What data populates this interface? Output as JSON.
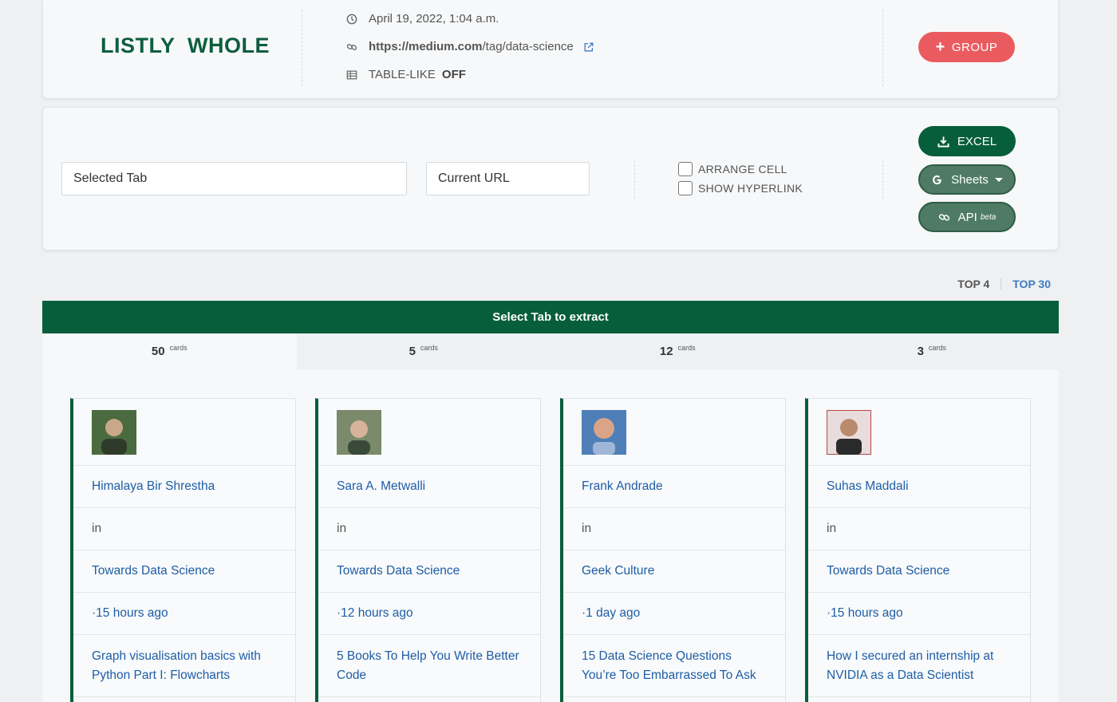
{
  "header": {
    "brand": "LISTLY  WHOLE",
    "timestamp": "April 19, 2022, 1:04 a.m.",
    "url_host": "https://medium.com",
    "url_path": "/tag/data-science",
    "table_like_label": "TABLE-LIKE",
    "table_like_value": "OFF",
    "group_button": "GROUP"
  },
  "controls": {
    "selected_tab": "Selected Tab",
    "current_url": "Current URL",
    "arrange_cell": "ARRANGE CELL",
    "show_hyperlink": "SHOW HYPERLINK",
    "excel_button": "EXCEL",
    "sheets_button": "Sheets",
    "api_button": "API",
    "api_badge": "beta"
  },
  "top_links": {
    "top4": "TOP 4",
    "top30": "TOP 30"
  },
  "extract_bar": "Select Tab to extract",
  "tabs": [
    {
      "count": "50",
      "label": "cards"
    },
    {
      "count": "5",
      "label": "cards"
    },
    {
      "count": "12",
      "label": "cards"
    },
    {
      "count": "3",
      "label": "cards"
    }
  ],
  "cards": [
    {
      "author": "Himalaya Bir Shrestha",
      "in": "in",
      "publication": "Towards Data Science",
      "time": "·15 hours ago",
      "title": "Graph visualisation basics with Python Part I: Flowcharts",
      "avatar_color": "#4a6b3f"
    },
    {
      "author": "Sara A. Metwalli",
      "in": "in",
      "publication": "Towards Data Science",
      "time": "·12 hours ago",
      "title": "5 Books To Help You Write Better Code",
      "avatar_color": "#7b8a6a"
    },
    {
      "author": "Frank Andrade",
      "in": "in",
      "publication": "Geek Culture",
      "time": "·1 day ago",
      "title": "15 Data Science Questions You’re Too Embarrassed To Ask",
      "avatar_color": "#4f7fb8"
    },
    {
      "author": "Suhas Maddali",
      "in": "in",
      "publication": "Towards Data Science",
      "time": "·15 hours ago",
      "title": "How I secured an internship at NVIDIA as a Data Scientist",
      "avatar_color": "#b24a48"
    }
  ]
}
